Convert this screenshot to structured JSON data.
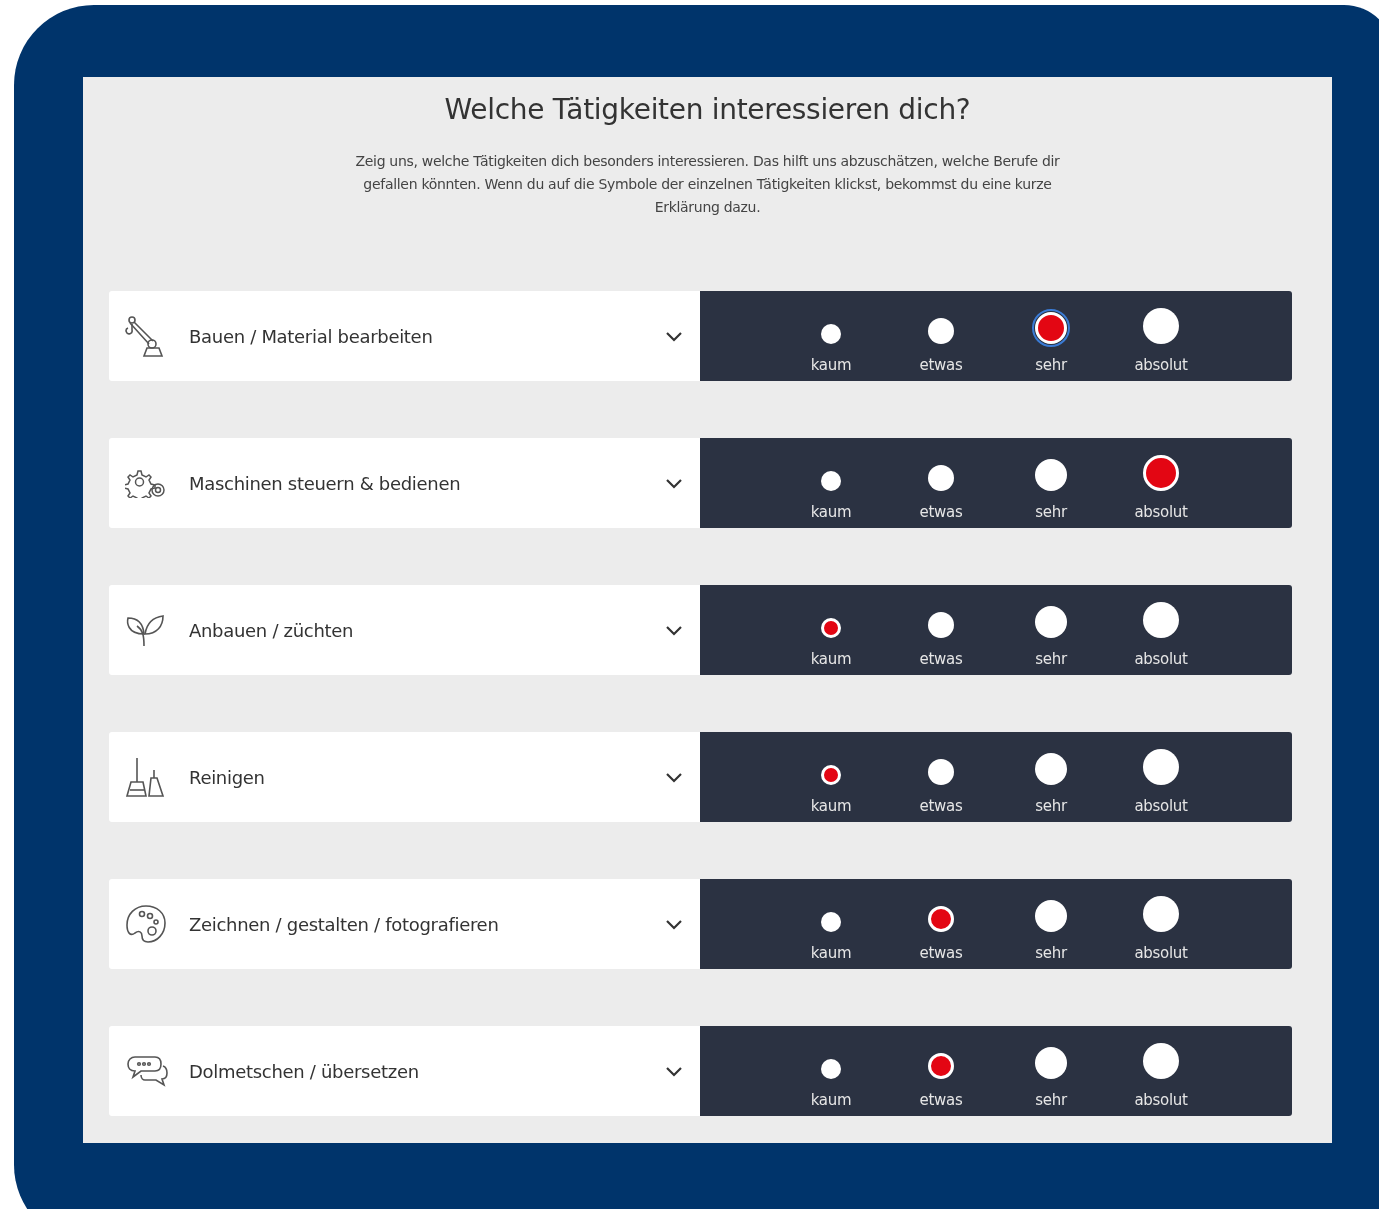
{
  "title": "Welche Tätigkeiten interessieren dich?",
  "description": "Zeig uns, welche Tätigkeiten dich besonders interessieren. Das hilft uns abzuschätzen, welche Berufe dir gefallen könnten. Wenn du auf die Symbole der einzelnen Tätigkeiten klickst, bekommst du eine kurze Erklärung dazu.",
  "activities": [
    {
      "kind": "crane",
      "label": "Bauen / Material bearbeiten",
      "expanded": false,
      "options": [
        {
          "label": "kaum",
          "selected": false,
          "focused": false
        },
        {
          "label": "etwas",
          "selected": false,
          "focused": false
        },
        {
          "label": "sehr",
          "selected": true,
          "focused": true
        },
        {
          "label": "absolut",
          "selected": false,
          "focused": false
        }
      ]
    },
    {
      "kind": "gears",
      "label": "Maschinen steuern & bedienen",
      "expanded": false,
      "options": [
        {
          "label": "kaum",
          "selected": false,
          "focused": false
        },
        {
          "label": "etwas",
          "selected": false,
          "focused": false
        },
        {
          "label": "sehr",
          "selected": false,
          "focused": false
        },
        {
          "label": "absolut",
          "selected": true,
          "focused": false
        }
      ]
    },
    {
      "kind": "sprout",
      "label": "Anbauen / züchten",
      "expanded": false,
      "options": [
        {
          "label": "kaum",
          "selected": true,
          "focused": false
        },
        {
          "label": "etwas",
          "selected": false,
          "focused": false
        },
        {
          "label": "sehr",
          "selected": false,
          "focused": false
        },
        {
          "label": "absolut",
          "selected": false,
          "focused": false
        }
      ]
    },
    {
      "kind": "broom",
      "label": "Reinigen",
      "expanded": false,
      "options": [
        {
          "label": "kaum",
          "selected": true,
          "focused": false
        },
        {
          "label": "etwas",
          "selected": false,
          "focused": false
        },
        {
          "label": "sehr",
          "selected": false,
          "focused": false
        },
        {
          "label": "absolut",
          "selected": false,
          "focused": false
        }
      ]
    },
    {
      "kind": "palette",
      "label": "Zeichnen / gestalten / fotografieren",
      "expanded": false,
      "options": [
        {
          "label": "kaum",
          "selected": false,
          "focused": false
        },
        {
          "label": "etwas",
          "selected": true,
          "focused": false
        },
        {
          "label": "sehr",
          "selected": false,
          "focused": false
        },
        {
          "label": "absolut",
          "selected": false,
          "focused": false
        }
      ]
    },
    {
      "kind": "speech",
      "label": "Dolmetschen / übersetzen",
      "expanded": false,
      "options": [
        {
          "label": "kaum",
          "selected": false,
          "focused": false
        },
        {
          "label": "etwas",
          "selected": true,
          "focused": false
        },
        {
          "label": "sehr",
          "selected": false,
          "focused": false
        },
        {
          "label": "absolut",
          "selected": false,
          "focused": false
        }
      ]
    }
  ]
}
